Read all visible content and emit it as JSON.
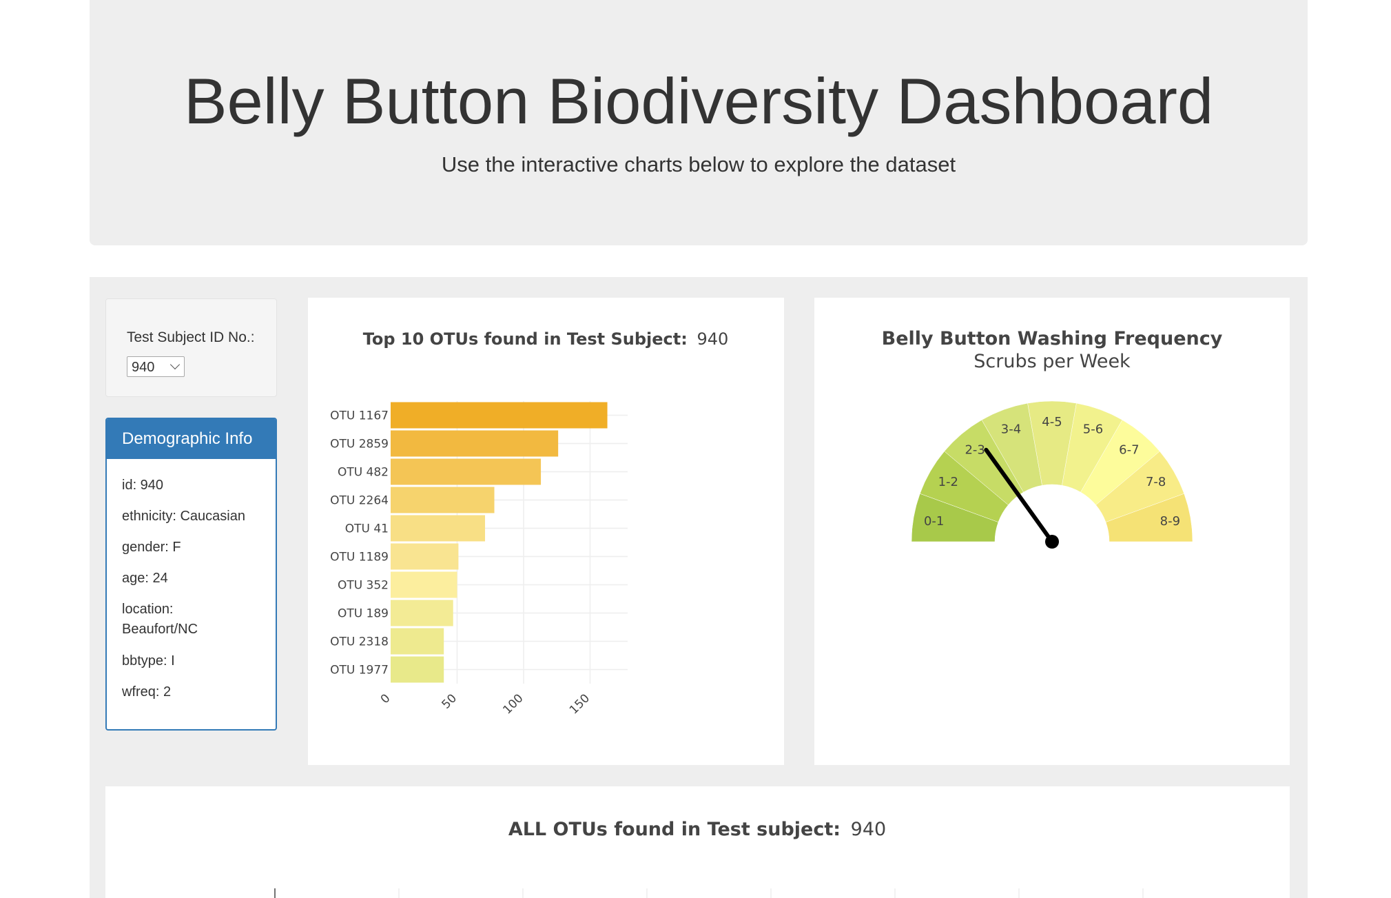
{
  "header": {
    "title": "Belly Button Biodiversity Dashboard",
    "subtitle": "Use the interactive charts below to explore the dataset"
  },
  "selector": {
    "label": "Test Subject ID No.:",
    "selected": "940"
  },
  "demographics": {
    "heading": "Demographic Info",
    "rows": [
      "id: 940",
      "ethnicity: Caucasian",
      "gender: F",
      "age: 24",
      "location:",
      "Beaufort/NC",
      "bbtype: I",
      "wfreq: 2"
    ]
  },
  "bar_chart": {
    "title_bold": "Top 10 OTUs found in Test Subject:",
    "title_value": "940"
  },
  "gauge_chart": {
    "title": "Belly Button Washing Frequency",
    "subtitle": "Scrubs per Week"
  },
  "bubble_chart": {
    "title_bold": "ALL OTUs found in Test subject:",
    "title_value": "940"
  },
  "chart_data": [
    {
      "type": "bar",
      "orientation": "horizontal",
      "categories": [
        "OTU 1167",
        "OTU 2859",
        "OTU 482",
        "OTU 2264",
        "OTU 41",
        "OTU 1189",
        "OTU 352",
        "OTU 189",
        "OTU 2318",
        "OTU 1977"
      ],
      "values": [
        163,
        126,
        113,
        78,
        71,
        51,
        50,
        47,
        40,
        40
      ],
      "colors": [
        "#f0ae27",
        "#f2b940",
        "#f4c555",
        "#f6d36d",
        "#f8df85",
        "#f9e491",
        "#fcee9e",
        "#f3eb95",
        "#eeea8f",
        "#e8e98a"
      ],
      "xticks": [
        0,
        50,
        100,
        150
      ],
      "xlim": [
        0,
        171
      ],
      "grid": true
    },
    {
      "type": "gauge",
      "value": 2,
      "range": [
        0,
        9
      ],
      "steps": [
        "0-1",
        "1-2",
        "2-3",
        "3-4",
        "4-5",
        "5-6",
        "6-7",
        "7-8",
        "8-9"
      ],
      "step_colors": [
        "#a8c94a",
        "#b5d151",
        "#c7dc66",
        "#d6e37a",
        "#e6ea84",
        "#f2f28d",
        "#fdfc9b",
        "#f8ec87",
        "#f5e275"
      ]
    }
  ]
}
